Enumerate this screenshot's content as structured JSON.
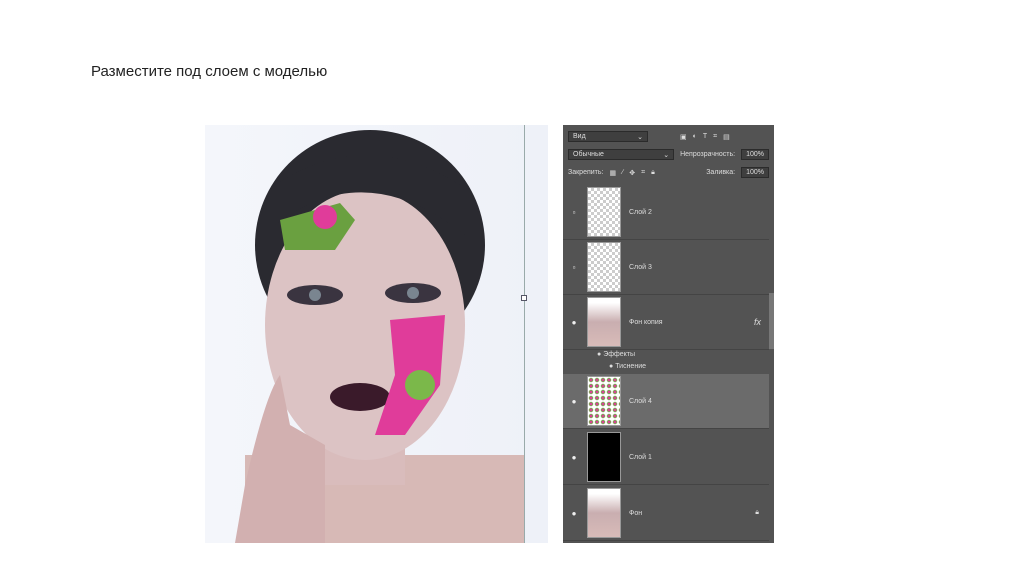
{
  "slide": {
    "title": "Разместите под слоем с моделью"
  },
  "panel": {
    "filter_label": "Вид",
    "blend_mode": "Обычные",
    "opacity_label": "Непрозрачность:",
    "opacity_value": "100%",
    "lock_label": "Закрепить:",
    "fill_label": "Заливка:",
    "fill_value": "100%",
    "layers": [
      {
        "name": "Слой 2",
        "visible": false
      },
      {
        "name": "Слой 3",
        "visible": false
      },
      {
        "name": "Фон копия",
        "visible": true,
        "fx": "fx"
      },
      {
        "name": "Слой 4",
        "visible": true,
        "selected": true
      },
      {
        "name": "Слой 1",
        "visible": true
      },
      {
        "name": "Фон",
        "visible": true,
        "locked": true
      }
    ],
    "effects_label": "Эффекты",
    "effect_name": "Тиснение"
  }
}
